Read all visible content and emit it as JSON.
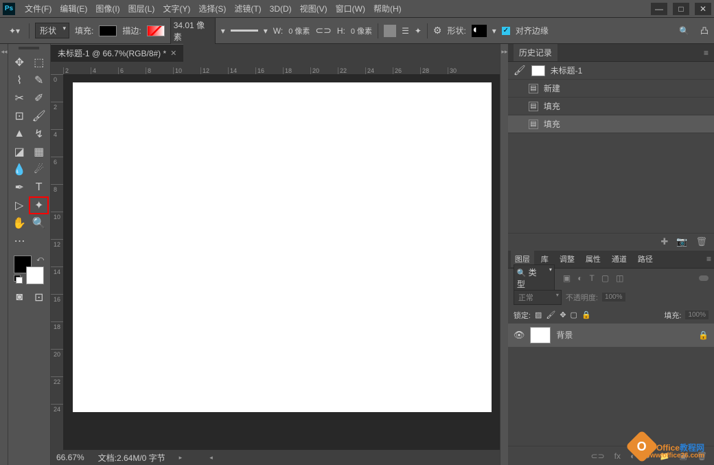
{
  "menu": [
    "文件(F)",
    "编辑(E)",
    "图像(I)",
    "图层(L)",
    "文字(Y)",
    "选择(S)",
    "滤镜(T)",
    "3D(D)",
    "视图(V)",
    "窗口(W)",
    "帮助(H)"
  ],
  "optbar": {
    "shape_mode": "形状",
    "fill": "填充:",
    "stroke": "描边:",
    "stroke_val": "34.01 像素",
    "w": "W:",
    "w_val": "0 像素",
    "h": "H:",
    "h_val": "0 像素",
    "shape": "形状:",
    "align": "对齐边缘"
  },
  "tab": {
    "title": "未标题-1 @ 66.7%(RGB/8#) *"
  },
  "ruler_h": [
    "2",
    "4",
    "6",
    "8",
    "10",
    "12",
    "14",
    "16",
    "18",
    "20",
    "22",
    "24",
    "26",
    "28",
    "30"
  ],
  "ruler_v": [
    "0",
    "2",
    "4",
    "6",
    "8",
    "10",
    "12",
    "14",
    "16",
    "18",
    "20",
    "22",
    "24"
  ],
  "status": {
    "zoom": "66.67%",
    "doc": "文档:2.64M/0 字节"
  },
  "history": {
    "title": "历史记录",
    "doc": "未标题-1",
    "items": [
      "新建",
      "填充",
      "填充"
    ]
  },
  "layers": {
    "tabs": [
      "图层",
      "库",
      "调整",
      "属性",
      "通道",
      "路径"
    ],
    "filter_label": "类型",
    "blend": "正常",
    "opacity_label": "不透明度:",
    "opacity_val": "100%",
    "lock": "锁定:",
    "fill_label": "填充:",
    "fill_val": "100%",
    "layer_name": "背景"
  },
  "watermark": {
    "brand": "Office",
    "suffix": "教程网",
    "url": "www.office26.com"
  }
}
